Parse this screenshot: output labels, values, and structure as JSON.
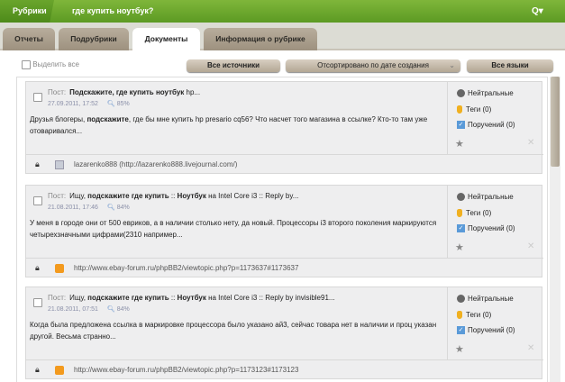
{
  "header": {
    "rubrics": "Рубрики",
    "query": "где купить ноутбук?",
    "search_icon": "Q▾"
  },
  "tabs": [
    "Отчеты",
    "Подрубрики",
    "Документы",
    "Информация о рубрике"
  ],
  "toolbar": {
    "select_all": "Выделить все",
    "sources": "Все источники",
    "sort": "Отсортировано по дате создания",
    "languages": "Все языки"
  },
  "cards": [
    {
      "label": "Пост:",
      "title_bold": "Подскажите, где купить ноутбук",
      "title_rest": " hp...",
      "date": "27.09.2011, 17:52",
      "relevance": "85%",
      "body": "Друзья блогеры, <b>подскажите</b>, где бы мне купить hp presario cq56? Что насчет того магазина в ссылке? Кто-то там уже отоваривался...",
      "tone": "Нейтральные",
      "tags": "Теги (0)",
      "tasks": "Поручений (0)",
      "source_type": "blog",
      "url": "lazarenko888 (http://lazarenko888.livejournal.com/)"
    },
    {
      "label": "Пост:",
      "title_pre": "Ищу, ",
      "title_bold": "подскажите где купить",
      "title_mid": " :: ",
      "title_bold2": "Ноутбук",
      "title_rest": " на Intel Core i3 :: Reply by...",
      "date": "21.08.2011, 17:46",
      "relevance": "84%",
      "body": "У меня в городе они от 500 евриков, а в наличии столько нету, да новый. Процессоры i3 второго поколения маркируются четырехзначными цифрами(2310 например...",
      "tone": "Нейтральные",
      "tags": "Теги (0)",
      "tasks": "Поручений (0)",
      "source_type": "rss",
      "url": "http://www.ebay-forum.ru/phpBB2/viewtopic.php?p=1173637#1173637"
    },
    {
      "label": "Пост:",
      "title_pre": "Ищу, ",
      "title_bold": "подскажите где купить",
      "title_mid": " :: ",
      "title_bold2": "Ноутбук",
      "title_rest": " на Intel Core i3 :: Reply by invisible91...",
      "date": "21.08.2011, 07:51",
      "relevance": "84%",
      "body": "Когда была предложена ссылка в маркировке процессора было указано ай3, сейчас товара нет в наличии и проц указан другой. Весьма странно...",
      "tone": "Нейтральные",
      "tags": "Теги (0)",
      "tasks": "Поручений (0)",
      "source_type": "rss",
      "url": "http://www.ebay-forum.ru/phpBB2/viewtopic.php?p=1173123#1173123"
    }
  ]
}
